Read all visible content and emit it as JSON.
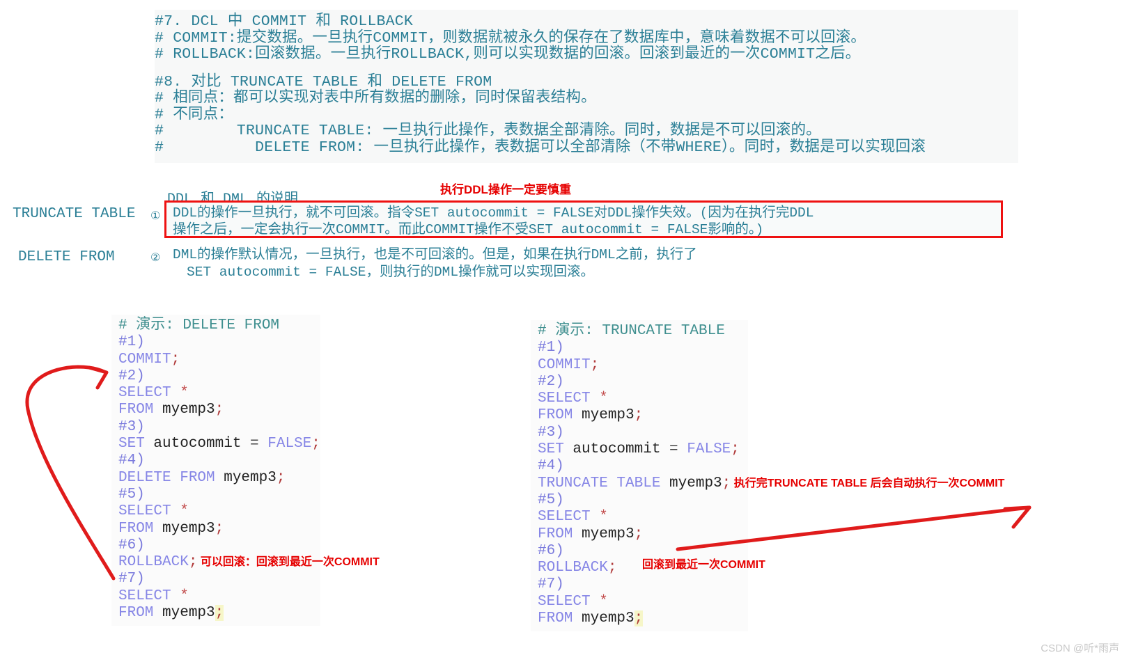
{
  "notes": {
    "section7": [
      "#7. DCL 中 COMMIT 和 ROLLBACK",
      "# COMMIT:提交数据。一旦执行COMMIT，则数据就被永久的保存在了数据库中，意味着数据不可以回滚。",
      "# ROLLBACK:回滚数据。一旦执行ROLLBACK,则可以实现数据的回滚。回滚到最近的一次COMMIT之后。"
    ],
    "section8": [
      "#8. 对比 TRUNCATE TABLE 和 DELETE FROM",
      "# 相同点：都可以实现对表中所有数据的删除，同时保留表结构。",
      "# 不同点：",
      "#        TRUNCATE TABLE: 一旦执行此操作，表数据全部清除。同时，数据是不可以回滚的。",
      "#          DELETE FROM: 一旦执行此操作，表数据可以全部清除（不带WHERE）。同时，数据是可以实现回滚"
    ]
  },
  "ddl_dml": {
    "title": "DDL 和 DML 的说明",
    "red_caption": "执行DDL操作一定要慎重",
    "left_labels": [
      "TRUNCATE TABLE",
      "DELETE FROM"
    ],
    "bullets": [
      "①",
      "②"
    ],
    "item1_lines": [
      "DDL的操作一旦执行，就不可回滚。指令SET autocommit = FALSE对DDL操作失效。(因为在执行完DDL",
      "操作之后，一定会执行一次COMMIT。而此COMMIT操作不受SET autocommit = FALSE影响的。)"
    ],
    "item2_lines": [
      "DML的操作默认情况，一旦执行，也是不可回滚的。但是，如果在执行DML之前，执行了",
      "SET autocommit = FALSE，则执行的DML操作就可以实现回滚。"
    ]
  },
  "code_left": {
    "header": "# 演示: DELETE FROM",
    "lines": [
      {
        "no": "#1)"
      },
      {
        "kw": "COMMIT",
        "semi": ";"
      },
      {
        "no": "#2)"
      },
      {
        "kw": "SELECT",
        "star": " *"
      },
      {
        "kw": "FROM",
        "pln": " myemp3",
        "semi": ";"
      },
      {
        "no": "#3)"
      },
      {
        "kw": "SET",
        "pln": " autocommit ",
        "op": "= ",
        "kw2": "FALSE",
        "semi": ";"
      },
      {
        "no": "#4)"
      },
      {
        "kw": "DELETE FROM",
        "pln": " myemp3",
        "semi": ";"
      },
      {
        "no": "#5)"
      },
      {
        "kw": "SELECT",
        "star": " *"
      },
      {
        "kw": "FROM",
        "pln": " myemp3",
        "semi": ";"
      },
      {
        "no": "#6)"
      },
      {
        "kw": "ROLLBACK",
        "semi": ";",
        "ann": " 可以回滚：回滚到最近一次COMMIT"
      },
      {
        "no": "#7)"
      },
      {
        "kw": "SELECT",
        "star": " *"
      },
      {
        "kw": "FROM",
        "pln": " myemp3",
        "semi": ";"
      }
    ]
  },
  "code_right": {
    "header": "# 演示: TRUNCATE TABLE",
    "lines": [
      {
        "no": "#1)"
      },
      {
        "kw": "COMMIT",
        "semi": ";"
      },
      {
        "no": "#2)"
      },
      {
        "kw": "SELECT",
        "star": " *"
      },
      {
        "kw": "FROM",
        "pln": " myemp3",
        "semi": ";"
      },
      {
        "no": "#3)"
      },
      {
        "kw": "SET",
        "pln": " autocommit ",
        "op": "= ",
        "kw2": "FALSE",
        "semi": ";"
      },
      {
        "no": "#4)"
      },
      {
        "kw": "TRUNCATE TABLE",
        "pln": " myemp3",
        "semi": ";",
        "ann": " 执行完TRUNCATE TABLE 后会自动执行一次COMMIT"
      },
      {
        "no": "#5)"
      },
      {
        "kw": "SELECT",
        "star": " *"
      },
      {
        "kw": "FROM",
        "pln": " myemp3",
        "semi": ";"
      },
      {
        "no": "#6)"
      },
      {
        "kw": "ROLLBACK",
        "semi": ";"
      },
      {
        "no": "#7)"
      },
      {
        "kw": "SELECT",
        "star": " *"
      },
      {
        "kw": "FROM",
        "pln": " myemp3",
        "semi": ";"
      }
    ]
  },
  "annotations": {
    "rollback_right": "回滚到最近一次COMMIT"
  },
  "watermark": "CSDN @听*雨声",
  "colors": {
    "note_text": "#2b7f96",
    "keyword": "#8686e6",
    "comment": "#3f8f8f",
    "annotation_red": "#e60000",
    "box_red": "#ee1111"
  }
}
